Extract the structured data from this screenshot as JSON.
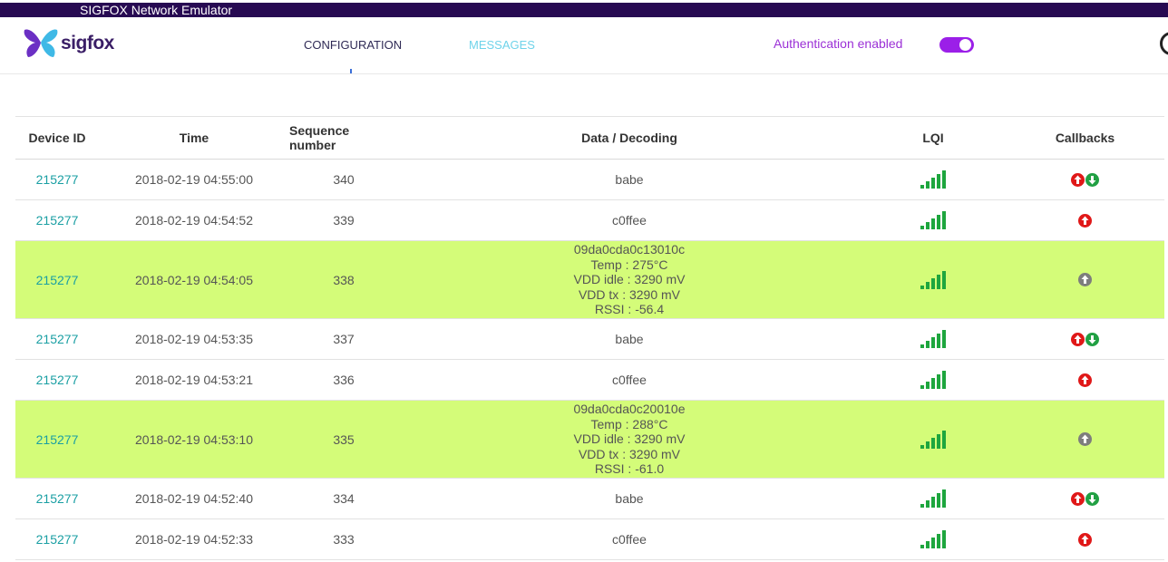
{
  "window": {
    "title": "SIGFOX Network Emulator"
  },
  "header": {
    "logo_text": "sigfox",
    "nav": [
      {
        "label": "CONFIGURATION"
      },
      {
        "label": "MESSAGES"
      }
    ],
    "auth_label": "Authentication enabled",
    "auth_enabled": true
  },
  "colors": {
    "highlight_row": "#d4fc79",
    "device_link": "#1a9fa3",
    "callback_up": "#e01818",
    "callback_down": "#21a043",
    "callback_pending": "#7d7d7d",
    "lqi_bars": "#1ea63e"
  },
  "table": {
    "headers": [
      "Device ID",
      "Time",
      "Sequence number",
      "Data / Decoding",
      "LQI",
      "Callbacks"
    ],
    "rows": [
      {
        "device": "215277",
        "time": "2018-02-19 04:55:00",
        "seq": "340",
        "data": [
          "babe"
        ],
        "highlight": false,
        "lqi": "excellent",
        "callbacks": [
          "up-success",
          "down-success"
        ]
      },
      {
        "device": "215277",
        "time": "2018-02-19 04:54:52",
        "seq": "339",
        "data": [
          "c0ffee"
        ],
        "highlight": false,
        "lqi": "excellent",
        "callbacks": [
          "up-success"
        ]
      },
      {
        "device": "215277",
        "time": "2018-02-19 04:54:05",
        "seq": "338",
        "data": [
          "09da0cda0c13010c",
          "Temp : 275°C",
          "VDD idle : 3290 mV",
          "VDD tx : 3290 mV",
          "RSSI : -56.4"
        ],
        "highlight": true,
        "lqi": "excellent",
        "callbacks": [
          "up-pending"
        ]
      },
      {
        "device": "215277",
        "time": "2018-02-19 04:53:35",
        "seq": "337",
        "data": [
          "babe"
        ],
        "highlight": false,
        "lqi": "excellent",
        "callbacks": [
          "up-success",
          "down-success"
        ]
      },
      {
        "device": "215277",
        "time": "2018-02-19 04:53:21",
        "seq": "336",
        "data": [
          "c0ffee"
        ],
        "highlight": false,
        "lqi": "excellent",
        "callbacks": [
          "up-success"
        ]
      },
      {
        "device": "215277",
        "time": "2018-02-19 04:53:10",
        "seq": "335",
        "data": [
          "09da0cda0c20010e",
          "Temp : 288°C",
          "VDD idle : 3290 mV",
          "VDD tx : 3290 mV",
          "RSSI : -61.0"
        ],
        "highlight": true,
        "lqi": "excellent",
        "callbacks": [
          "up-pending"
        ]
      },
      {
        "device": "215277",
        "time": "2018-02-19 04:52:40",
        "seq": "334",
        "data": [
          "babe"
        ],
        "highlight": false,
        "lqi": "excellent",
        "callbacks": [
          "up-success",
          "down-success"
        ]
      },
      {
        "device": "215277",
        "time": "2018-02-19 04:52:33",
        "seq": "333",
        "data": [
          "c0ffee"
        ],
        "highlight": false,
        "lqi": "excellent",
        "callbacks": [
          "up-success"
        ]
      }
    ]
  }
}
